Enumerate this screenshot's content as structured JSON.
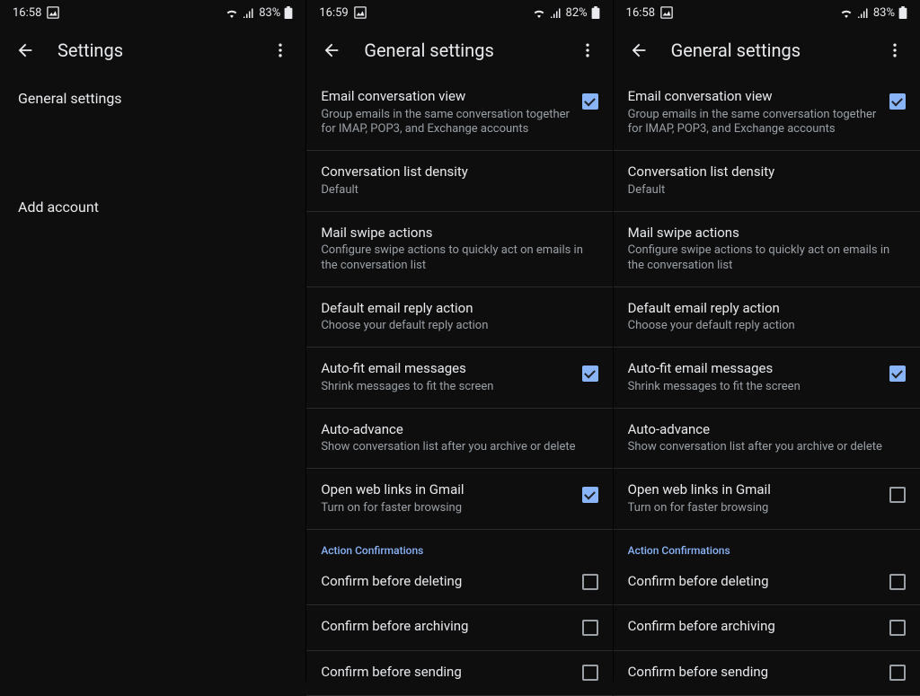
{
  "screens": [
    {
      "status": {
        "time": "16:58",
        "battery": "83%"
      },
      "title": "Settings",
      "type": "main",
      "items": [
        {
          "label": "General settings"
        },
        {
          "label": "Add account"
        }
      ]
    },
    {
      "status": {
        "time": "16:59",
        "battery": "82%"
      },
      "title": "General settings",
      "type": "general",
      "settings": [
        {
          "title": "Email conversation view",
          "subtitle": "Group emails in the same conversation together for IMAP, POP3, and Exchange accounts",
          "checkbox": true,
          "checked": true
        },
        {
          "title": "Conversation list density",
          "subtitle": "Default"
        },
        {
          "title": "Mail swipe actions",
          "subtitle": "Configure swipe actions to quickly act on emails in the conversation list"
        },
        {
          "title": "Default email reply action",
          "subtitle": "Choose your default reply action"
        },
        {
          "title": "Auto-fit email messages",
          "subtitle": "Shrink messages to fit the screen",
          "checkbox": true,
          "checked": true
        },
        {
          "title": "Auto-advance",
          "subtitle": "Show conversation list after you archive or delete"
        },
        {
          "title": "Open web links in Gmail",
          "subtitle": "Turn on for faster browsing",
          "checkbox": true,
          "checked": true
        }
      ],
      "sectionHeader": "Action Confirmations",
      "confirmations": [
        {
          "title": "Confirm before deleting",
          "checked": false
        },
        {
          "title": "Confirm before archiving",
          "checked": false
        },
        {
          "title": "Confirm before sending",
          "checked": false
        }
      ]
    },
    {
      "status": {
        "time": "16:58",
        "battery": "83%"
      },
      "title": "General settings",
      "type": "general",
      "settings": [
        {
          "title": "Email conversation view",
          "subtitle": "Group emails in the same conversation together for IMAP, POP3, and Exchange accounts",
          "checkbox": true,
          "checked": true
        },
        {
          "title": "Conversation list density",
          "subtitle": "Default"
        },
        {
          "title": "Mail swipe actions",
          "subtitle": "Configure swipe actions to quickly act on emails in the conversation list"
        },
        {
          "title": "Default email reply action",
          "subtitle": "Choose your default reply action"
        },
        {
          "title": "Auto-fit email messages",
          "subtitle": "Shrink messages to fit the screen",
          "checkbox": true,
          "checked": true
        },
        {
          "title": "Auto-advance",
          "subtitle": "Show conversation list after you archive or delete"
        },
        {
          "title": "Open web links in Gmail",
          "subtitle": "Turn on for faster browsing",
          "checkbox": true,
          "checked": false
        }
      ],
      "sectionHeader": "Action Confirmations",
      "confirmations": [
        {
          "title": "Confirm before deleting",
          "checked": false
        },
        {
          "title": "Confirm before archiving",
          "checked": false
        },
        {
          "title": "Confirm before sending",
          "checked": false
        }
      ]
    }
  ]
}
